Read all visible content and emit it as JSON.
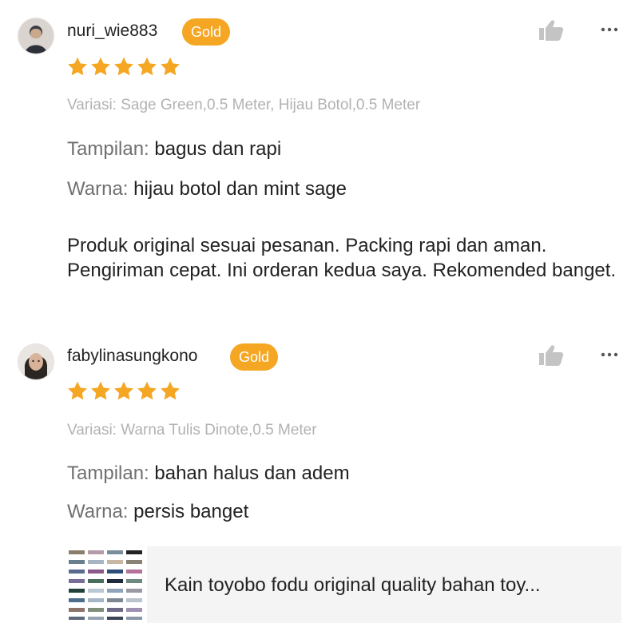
{
  "reviews": [
    {
      "username": "nuri_wie883",
      "badge": "Gold",
      "rating": 5,
      "variant": "Variasi: Sage Green,0.5 Meter, Hijau Botol,0.5 Meter",
      "attributes": [
        {
          "key": "Tampilan:",
          "value": "bagus dan rapi"
        },
        {
          "key": "Warna:",
          "value": "hijau botol dan mint sage"
        }
      ],
      "text": "Produk original sesuai pesanan. Packing rapi dan aman. Pengiriman cepat. Ini orderan kedua saya. Rekomended banget."
    },
    {
      "username": "fabylinasungkono",
      "badge": "Gold",
      "rating": 5,
      "variant": "Variasi: Warna Tulis Dinote,0.5 Meter",
      "attributes": [
        {
          "key": "Tampilan:",
          "value": "bahan halus dan adem"
        },
        {
          "key": "Warna:",
          "value": "persis banget"
        }
      ]
    }
  ],
  "product": {
    "title": "Kain toyobo fodu original quality bahan toy..."
  },
  "colors": {
    "badge": "#f5a623",
    "star": "#f5a623",
    "variant_text": "#b2b2b2",
    "attribute_key": "#707070",
    "product_bg": "#f4f4f4"
  },
  "icons": {
    "like": "thumbs-up-icon",
    "more": "more-options-icon",
    "star": "star-icon"
  }
}
